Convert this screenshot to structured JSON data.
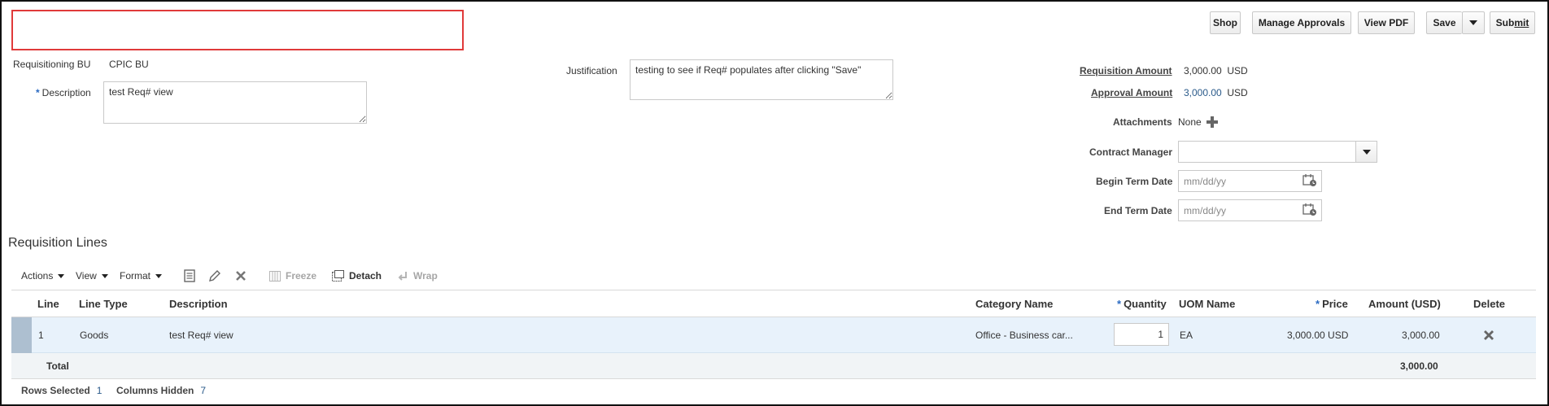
{
  "header_buttons": {
    "shop": "Shop",
    "manage_approvals": "Manage Approvals",
    "view_pdf": "View PDF",
    "save": "Save",
    "submit": "Submit"
  },
  "form": {
    "requisitioning_bu_label": "Requisitioning BU",
    "requisitioning_bu_value": "CPIC BU",
    "description_label": "Description",
    "description_value": "test Req# view",
    "justification_label": "Justification",
    "justification_value": "testing to see if Req# populates after clicking \"Save\"",
    "requisition_amount_label": "Requisition Amount",
    "requisition_amount_value": "3,000.00",
    "requisition_amount_currency": "USD",
    "approval_amount_label": "Approval Amount",
    "approval_amount_value": "3,000.00",
    "approval_amount_currency": "USD",
    "attachments_label": "Attachments",
    "attachments_value": "None",
    "contract_manager_label": "Contract Manager",
    "contract_manager_value": "",
    "begin_term_date_label": "Begin Term Date",
    "begin_term_date_placeholder": "mm/dd/yy",
    "end_term_date_label": "End Term Date",
    "end_term_date_placeholder": "mm/dd/yy",
    "required_marker": "*"
  },
  "lines": {
    "title": "Requisition Lines",
    "toolbar": {
      "actions": "Actions",
      "view": "View",
      "format": "Format",
      "freeze": "Freeze",
      "detach": "Detach",
      "wrap": "Wrap"
    },
    "columns": {
      "line": "Line",
      "line_type": "Line Type",
      "description": "Description",
      "category_name": "Category Name",
      "quantity": "Quantity",
      "uom_name": "UOM Name",
      "price": "Price",
      "amount": "Amount (USD)",
      "delete": "Delete"
    },
    "rows": [
      {
        "line": "1",
        "line_type": "Goods",
        "description": "test Req# view",
        "category_name": "Office - Business car...",
        "quantity": "1",
        "uom_name": "EA",
        "price": "3,000.00 USD",
        "amount": "3,000.00"
      }
    ],
    "total_label": "Total",
    "total_amount": "3,000.00",
    "status": {
      "rows_selected_label": "Rows Selected",
      "rows_selected_value": "1",
      "columns_hidden_label": "Columns Hidden",
      "columns_hidden_value": "7"
    }
  }
}
